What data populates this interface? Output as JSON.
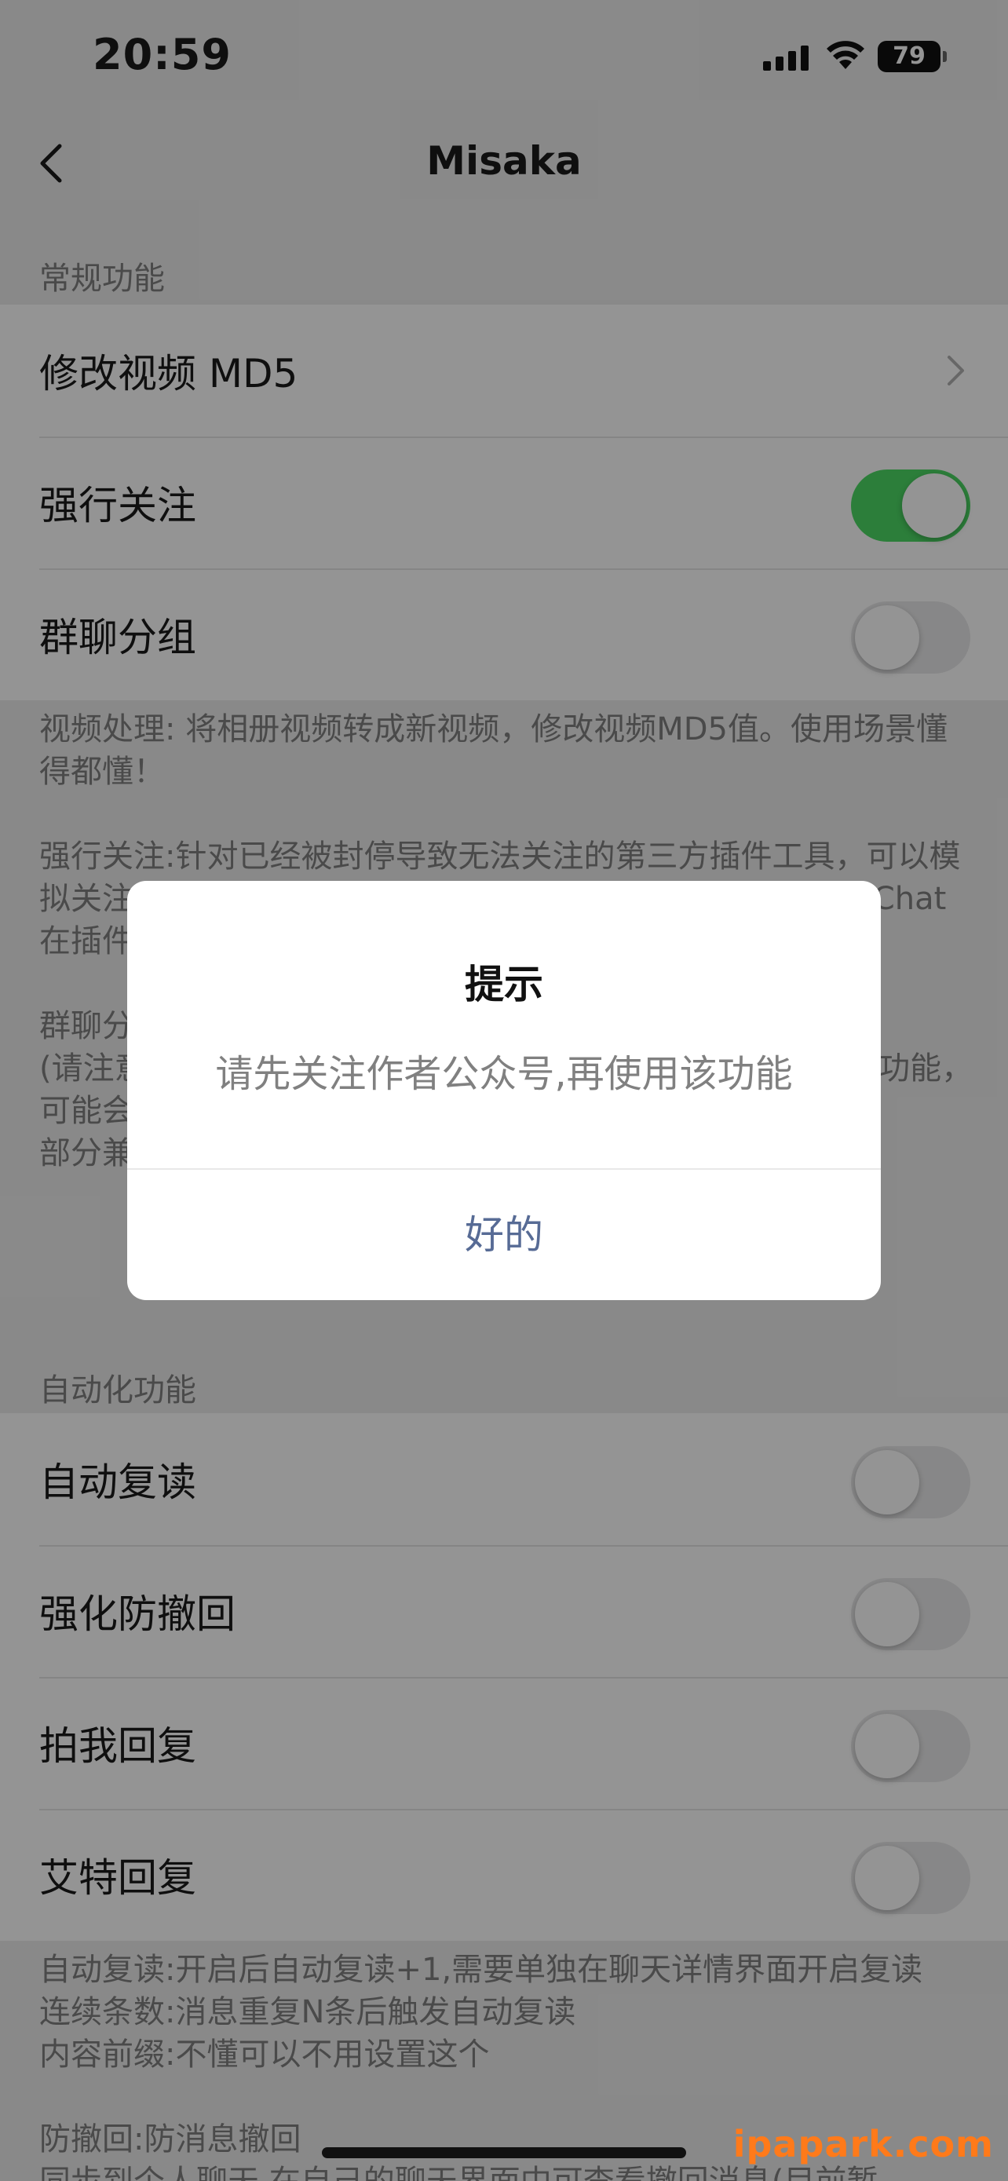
{
  "status_bar": {
    "time": "20:59",
    "battery": "79",
    "signal_icon": "cellular-signal-icon",
    "wifi_icon": "wifi-icon"
  },
  "nav": {
    "title": "Misaka",
    "back_icon": "chevron-left-icon"
  },
  "general": {
    "header": "常规功能",
    "items": [
      {
        "label": "修改视频 MD5",
        "control": "chevron"
      },
      {
        "label": "强行关注",
        "control": "toggle",
        "on": true
      },
      {
        "label": "群聊分组",
        "control": "toggle",
        "on": false
      }
    ],
    "footnote": "视频处理: 将相册视频转成新视频，修改视频MD5值。使用场景懂得都懂！\n\n强行关注:针对已经被封停导致无法关注的第三方插件工具，可以模拟关注并强行解锁功能。需对应的公众号消息中拍一拍，WeChat在插件中心，显示被屏蔽等关注情况时，请正常关注\n\n群聊分组:开启后聊天界面的群聊会被单独分组显示\n(请注意:如果你使用了其它插件有群聊分组功能，或其它相似功能，可能会产生冲突，请关闭其它插件相关或本功能)\n部分兼容问题，如遇到显示异常请关闭该功能并反馈，感谢！"
  },
  "automation": {
    "header": "自动化功能",
    "items": [
      {
        "label": "自动复读",
        "control": "toggle",
        "on": false
      },
      {
        "label": "强化防撤回",
        "control": "toggle",
        "on": false
      },
      {
        "label": "拍我回复",
        "control": "toggle",
        "on": false
      },
      {
        "label": "艾特回复",
        "control": "toggle",
        "on": false
      }
    ],
    "footnote": "自动复读:开启后自动复读+1,需要单独在聊天详情界面开启复读\n连续条数:消息重复N条后触发自动复读\n内容前缀:不懂可以不用设置这个\n\n防撤回:防消息撤回\n同步到个人聊天,在自己的聊天界面中可查看撤回消息(目前暂"
  },
  "dialog": {
    "title": "提示",
    "message": "请先关注作者公众号,再使用该功能",
    "button": "好的"
  },
  "watermark": "ipapark.com",
  "colors": {
    "toggle_on": "#4cd964",
    "dialog_button": "#576b95",
    "watermark": "#ff7a1a"
  }
}
